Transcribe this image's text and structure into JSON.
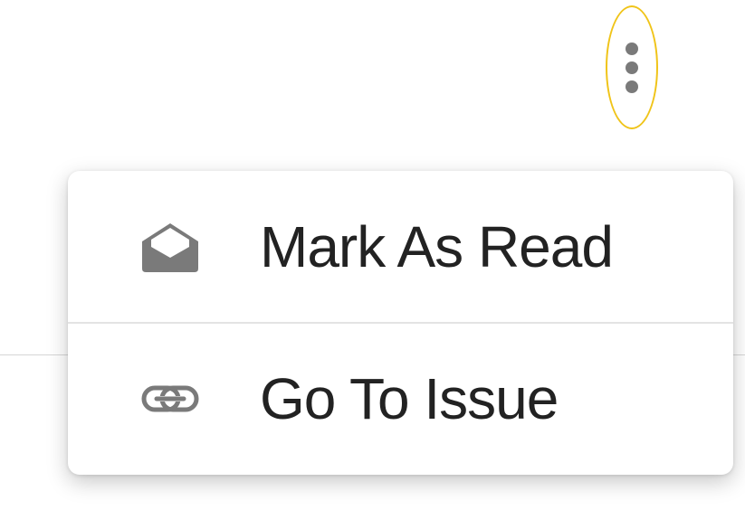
{
  "menu_button": {
    "icon": "more-vertical-icon",
    "highlight_color": "#f0c419"
  },
  "menu": {
    "items": [
      {
        "label": "Mark As Read",
        "icon": "envelope-open-icon"
      },
      {
        "label": "Go To Issue",
        "icon": "link-icon"
      }
    ]
  },
  "colors": {
    "icon": "#7a7a7a",
    "text": "#222222",
    "divider": "#e3e3e3"
  }
}
